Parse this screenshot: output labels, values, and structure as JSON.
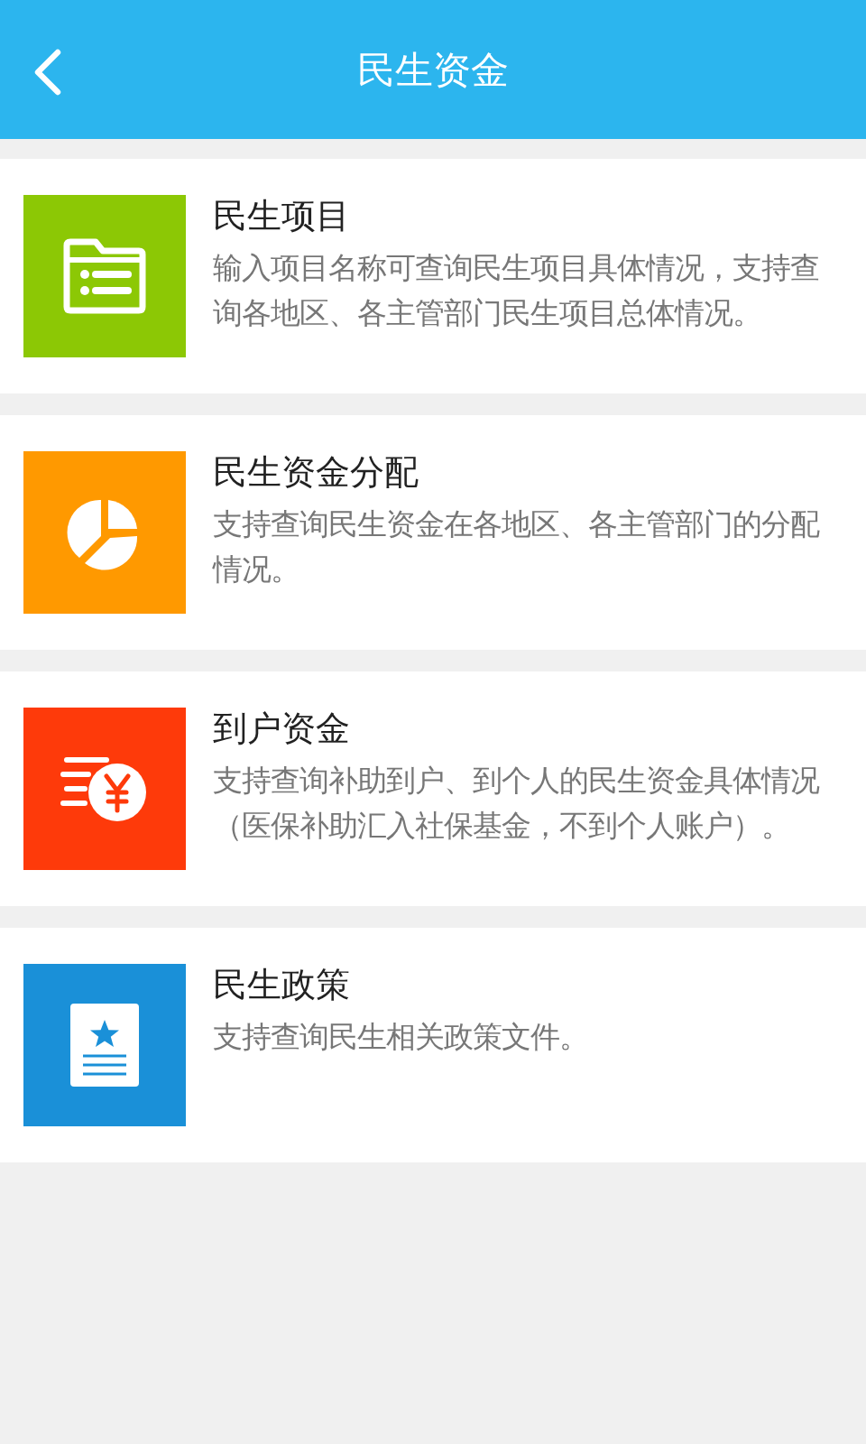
{
  "header": {
    "title": "民生资金"
  },
  "items": [
    {
      "kind": "folder",
      "color": "#8cc805",
      "title": "民生项目",
      "description": "输入项目名称可查询民生项目具体情况，支持查询各地区、各主管部门民生项目总体情况。"
    },
    {
      "kind": "pie",
      "color": "#ff9900",
      "title": "民生资金分配",
      "description": "支持查询民生资金在各地区、各主管部门的分配情况。"
    },
    {
      "kind": "money",
      "color": "#fe3a0a",
      "title": "到户资金",
      "description": "支持查询补助到户、到个人的民生资金具体情况（医保补助汇入社保基金，不到个人账户）。"
    },
    {
      "kind": "document",
      "color": "#1a90d8",
      "title": "民生政策",
      "description": "支持查询民生相关政策文件。"
    }
  ]
}
